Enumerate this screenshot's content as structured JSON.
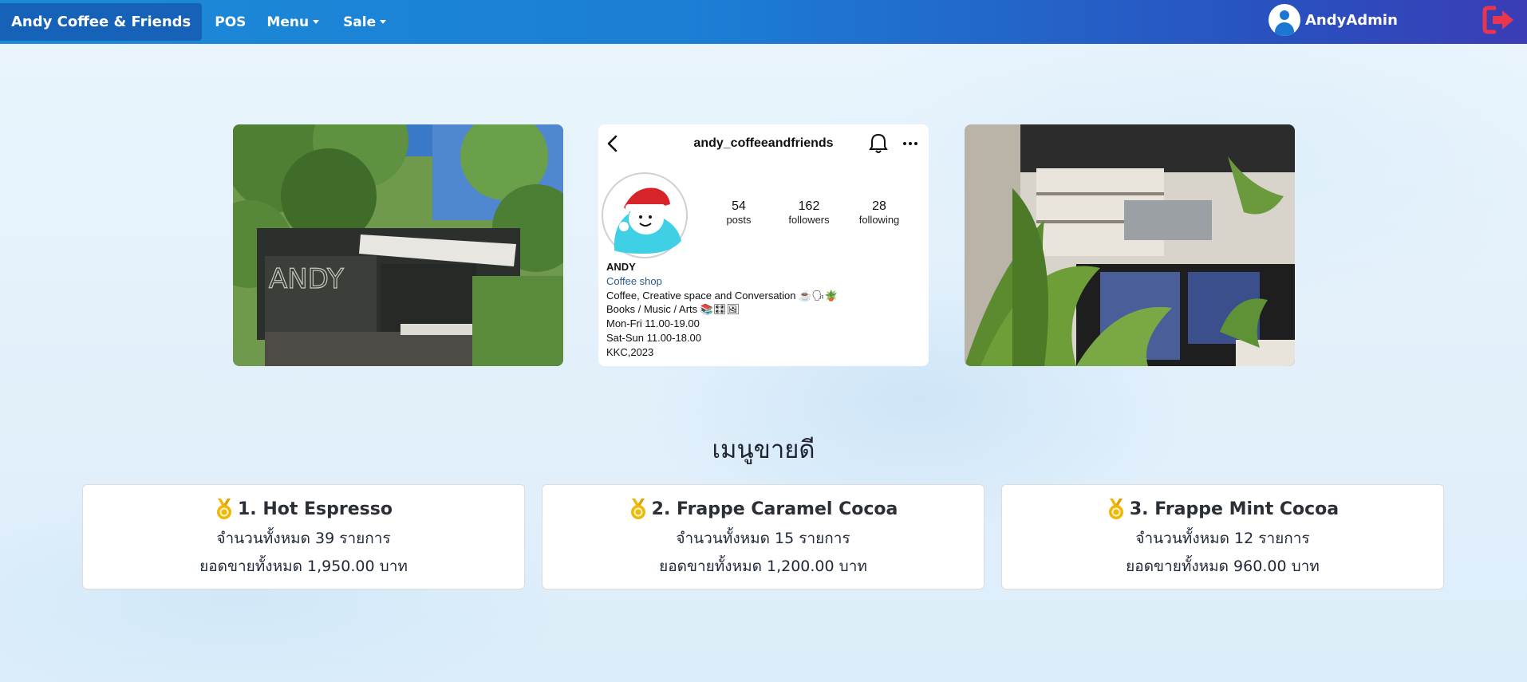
{
  "navbar": {
    "brand": "Andy Coffee & Friends",
    "links": [
      {
        "label": "POS"
      },
      {
        "label": "Menu"
      },
      {
        "label": "Sale"
      }
    ],
    "user": "AndyAdmin",
    "colors": {
      "start": "#1c8ad8",
      "end": "#3a3db5",
      "logout": "#e8364f"
    }
  },
  "instagram": {
    "handle": "andy_coffeeandfriends",
    "stats": [
      {
        "num": "54",
        "label": "posts"
      },
      {
        "num": "162",
        "label": "followers"
      },
      {
        "num": "28",
        "label": "following"
      }
    ],
    "bio": {
      "name": "ANDY",
      "category": "Coffee shop",
      "lines": [
        "Coffee, Creative space and Conversation ☕🗣🪴",
        "Books / Music / Arts 📚🎛🖼",
        "Mon-Fri 11.00-19.00",
        "Sat-Sun 11.00-18.00",
        "KKC,2023"
      ]
    }
  },
  "section": {
    "title": "เมนูขายดี"
  },
  "best_sellers": [
    {
      "title": "1. Hot Espresso",
      "qty": "จำนวนทั้งหมด 39 รายการ",
      "sales": "ยอดขายทั้งหมด 1,950.00 บาท"
    },
    {
      "title": "2. Frappe Caramel Cocoa",
      "qty": "จำนวนทั้งหมด 15 รายการ",
      "sales": "ยอดขายทั้งหมด 1,200.00 บาท"
    },
    {
      "title": "3. Frappe Mint Cocoa",
      "qty": "จำนวนทั้งหมด 12 รายการ",
      "sales": "ยอดขายทั้งหมด 960.00 บาท"
    }
  ],
  "icons": {
    "medal": "medal-icon",
    "user": "user-circle-icon",
    "logout": "logout-icon",
    "back": "chevron-left-icon",
    "bell": "bell-icon",
    "more": "more-horizontal-icon"
  }
}
